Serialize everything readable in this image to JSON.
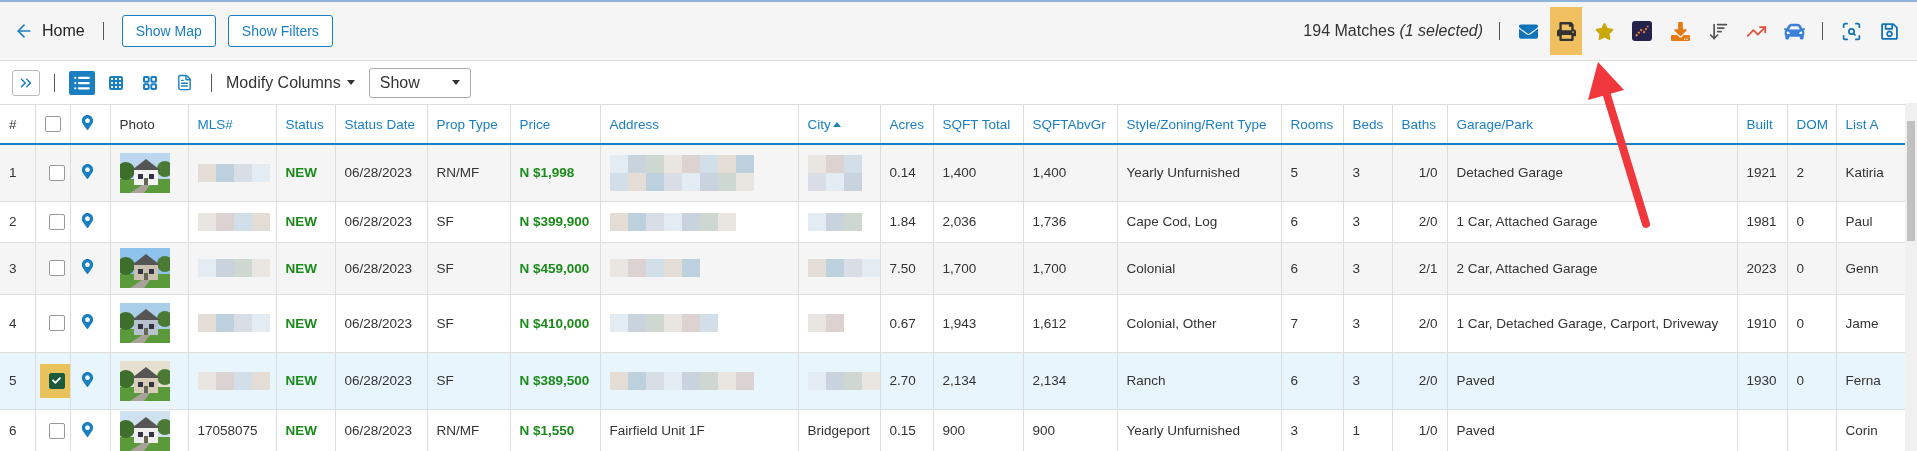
{
  "topbar": {
    "back_label": "Home",
    "buttons": [
      "Show Map",
      "Show Filters"
    ],
    "matches": "194 Matches *(1 selected)*",
    "tools": [
      {
        "kind": "mail",
        "highlighted": false
      },
      {
        "kind": "print",
        "highlighted": true
      },
      {
        "kind": "star",
        "highlighted": false
      },
      {
        "kind": "chart-box",
        "highlighted": false
      },
      {
        "kind": "download",
        "highlighted": false
      },
      {
        "kind": "sort",
        "highlighted": false
      },
      {
        "kind": "trend",
        "highlighted": false
      },
      {
        "kind": "car",
        "highlighted": false
      }
    ],
    "tools_end": [
      {
        "kind": "search",
        "highlighted": false
      },
      {
        "kind": "save",
        "highlighted": false
      }
    ]
  },
  "viewbar": {
    "views": [
      {
        "kind": "list",
        "selected": true
      },
      {
        "kind": "grid-small",
        "selected": false
      },
      {
        "kind": "grid-large",
        "selected": false
      },
      {
        "kind": "document",
        "selected": false
      }
    ],
    "modify_label": "Modify Columns",
    "show_select": "Show"
  },
  "table": {
    "columns": [
      {
        "label": "#",
        "kind": "plain",
        "sorted": false
      },
      {
        "kind": "checkbox",
        "checked": false,
        "sorted": false
      },
      {
        "kind": "pin",
        "sorted": false
      },
      {
        "label": "Photo",
        "kind": "plain",
        "sorted": false
      },
      {
        "label": "MLS#",
        "kind": "link",
        "sorted": false
      },
      {
        "label": "Status",
        "kind": "link",
        "sorted": false
      },
      {
        "label": "Status Date",
        "kind": "link",
        "sorted": false
      },
      {
        "label": "Prop Type",
        "kind": "link",
        "sorted": false
      },
      {
        "label": "Price",
        "kind": "link",
        "sorted": false
      },
      {
        "label": "Address",
        "kind": "link",
        "sorted": false
      },
      {
        "label": "City",
        "kind": "link",
        "sorted": true
      },
      {
        "label": "Acres",
        "kind": "link",
        "sorted": false
      },
      {
        "label": "SQFT Total",
        "kind": "link",
        "sorted": false
      },
      {
        "label": "SQFTAbvGr",
        "kind": "link",
        "sorted": false
      },
      {
        "label": "Style/Zoning/Rent Type",
        "kind": "link",
        "sorted": false
      },
      {
        "label": "Rooms",
        "kind": "link",
        "sorted": false
      },
      {
        "label": "Beds",
        "kind": "link",
        "sorted": false
      },
      {
        "label": "Baths",
        "kind": "link",
        "sorted": false
      },
      {
        "label": "Garage/Park",
        "kind": "link",
        "sorted": false
      },
      {
        "label": "Built",
        "kind": "link",
        "sorted": false
      },
      {
        "label": "DOM",
        "kind": "link",
        "sorted": false
      },
      {
        "label": "List A",
        "kind": "link",
        "sorted": false
      }
    ],
    "rows": [
      {
        "num": "1",
        "checked": false,
        "selected": false,
        "photo": true,
        "redacted": true,
        "status": "NEW",
        "date": "06/28/2023",
        "type": "RN/MF",
        "price": "N $1,998",
        "acres": "0.14",
        "sqft": "1,400",
        "sqft_abv": "1,400",
        "style": "Yearly Unfurnished",
        "rooms": "5",
        "beds": "3",
        "baths": "1/0",
        "garage": "Detached Garage",
        "built": "1921",
        "dom": "2",
        "agent": "Katiria"
      },
      {
        "num": "2",
        "checked": false,
        "selected": false,
        "photo": false,
        "redacted": true,
        "status": "NEW",
        "date": "06/28/2023",
        "type": "SF",
        "price": "N $399,900",
        "acres": "1.84",
        "sqft": "2,036",
        "sqft_abv": "1,736",
        "style": "Cape Cod, Log",
        "rooms": "6",
        "beds": "3",
        "baths": "2/0",
        "garage": "1 Car, Attached Garage",
        "built": "1981",
        "dom": "0",
        "agent": "Paul"
      },
      {
        "num": "3",
        "checked": false,
        "selected": false,
        "photo": true,
        "redacted": true,
        "status": "NEW",
        "date": "06/28/2023",
        "type": "SF",
        "price": "N $459,000",
        "acres": "7.50",
        "sqft": "1,700",
        "sqft_abv": "1,700",
        "style": "Colonial",
        "rooms": "6",
        "beds": "3",
        "baths": "2/1",
        "garage": "2 Car, Attached Garage",
        "built": "2023",
        "dom": "0",
        "agent": "Genn"
      },
      {
        "num": "4",
        "checked": false,
        "selected": false,
        "photo": true,
        "redacted": true,
        "status": "NEW",
        "date": "06/28/2023",
        "type": "SF",
        "price": "N $410,000",
        "acres": "0.67",
        "sqft": "1,943",
        "sqft_abv": "1,612",
        "style": "Colonial, Other",
        "rooms": "7",
        "beds": "3",
        "baths": "2/0",
        "garage": "1 Car, Detached Garage, Carport, Driveway",
        "built": "1910",
        "dom": "0",
        "agent": "Jame"
      },
      {
        "num": "5",
        "checked": true,
        "selected": true,
        "photo": true,
        "redacted": true,
        "status": "NEW",
        "date": "06/28/2023",
        "type": "SF",
        "price": "N $389,500",
        "acres": "2.70",
        "sqft": "2,134",
        "sqft_abv": "2,134",
        "style": "Ranch",
        "rooms": "6",
        "beds": "3",
        "baths": "2/0",
        "garage": "Paved",
        "built": "1930",
        "dom": "0",
        "agent": "Ferna"
      },
      {
        "num": "6",
        "checked": false,
        "selected": false,
        "photo": true,
        "redacted": false,
        "mls": "17058075",
        "status": "NEW",
        "date": "06/28/2023",
        "type": "RN/MF",
        "price": "N $1,550",
        "address": "Fairfield Unit 1F",
        "city": "Bridgeport",
        "acres": "0.15",
        "sqft": "900",
        "sqft_abv": "900",
        "style": "Yearly Unfurnished",
        "rooms": "3",
        "beds": "1",
        "baths": "1/0",
        "garage": "Paved",
        "agent": "Corin"
      }
    ]
  },
  "annotation_arrow": true
}
